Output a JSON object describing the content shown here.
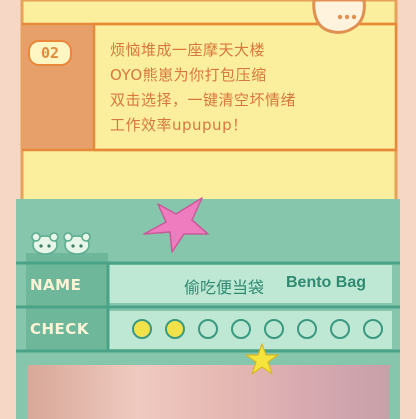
{
  "card": {
    "number": "02",
    "lines": [
      "烦恼堆成一座摩天大楼",
      "OYO熊崽为你打包压缩",
      "双击选择，一键清空坏情绪",
      "工作效率upupup！"
    ]
  },
  "name_row": {
    "label": "NAME",
    "chinese": "偷吃便当袋",
    "english": "Bento Bag"
  },
  "check_row": {
    "label": "CHECK",
    "filled": 2,
    "total": 8
  },
  "colors": {
    "yellow": "#fbef9e",
    "orange": "#e58a3a",
    "teal": "#85c6ac",
    "mint": "#bfe8d4",
    "pink_star": "#f07cc0",
    "yellow_star": "#f6e33c"
  }
}
